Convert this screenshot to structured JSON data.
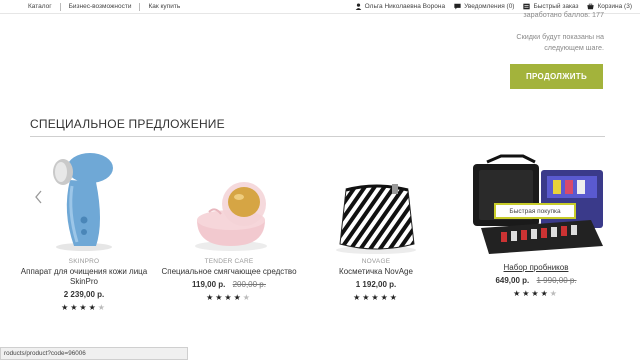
{
  "topbar": {
    "left_links": [
      "Каталог",
      "Бизнес-возможности",
      "Как купить"
    ],
    "user_name": "Ольга Николаевна Ворона",
    "notifications": "Уведомления (0)",
    "quick_order": "Быстрый заказ",
    "cart": "Корзина (3)"
  },
  "summary": {
    "earned_text": "заработано баллов: 177",
    "discount_note": "Скидки будут показаны на следующем шаге.",
    "continue_label": "ПРОДОЛЖИТЬ"
  },
  "special_offer": {
    "title": "СПЕЦИАЛЬНОЕ ПРЕДЛОЖЕНИЕ",
    "quick_buy_label": "Быстрая покупка",
    "products": [
      {
        "brand": "SKINPRO",
        "name": "Аппарат для очищения кожи лица SkinPro",
        "price": "2 239,00 р.",
        "old_price": "",
        "rating": 4.5
      },
      {
        "brand": "TENDER CARE",
        "name": "Специальное смягчающее средство",
        "price": "119,00 р.",
        "old_price": "200,00 р.",
        "rating": 4.5
      },
      {
        "brand": "NOVAGE",
        "name": "Косметичка NovAge",
        "price": "1 192,00 р.",
        "old_price": "",
        "rating": 5
      },
      {
        "brand": "",
        "name": "Набор пробников",
        "price": "649,00 р.",
        "old_price": "1 990,00 р.",
        "rating": 4
      }
    ]
  },
  "status_url": "roducts/product?code=96006",
  "colors": {
    "accent_green": "#a3b33b",
    "quick_buy_border": "#c8cc2a"
  }
}
